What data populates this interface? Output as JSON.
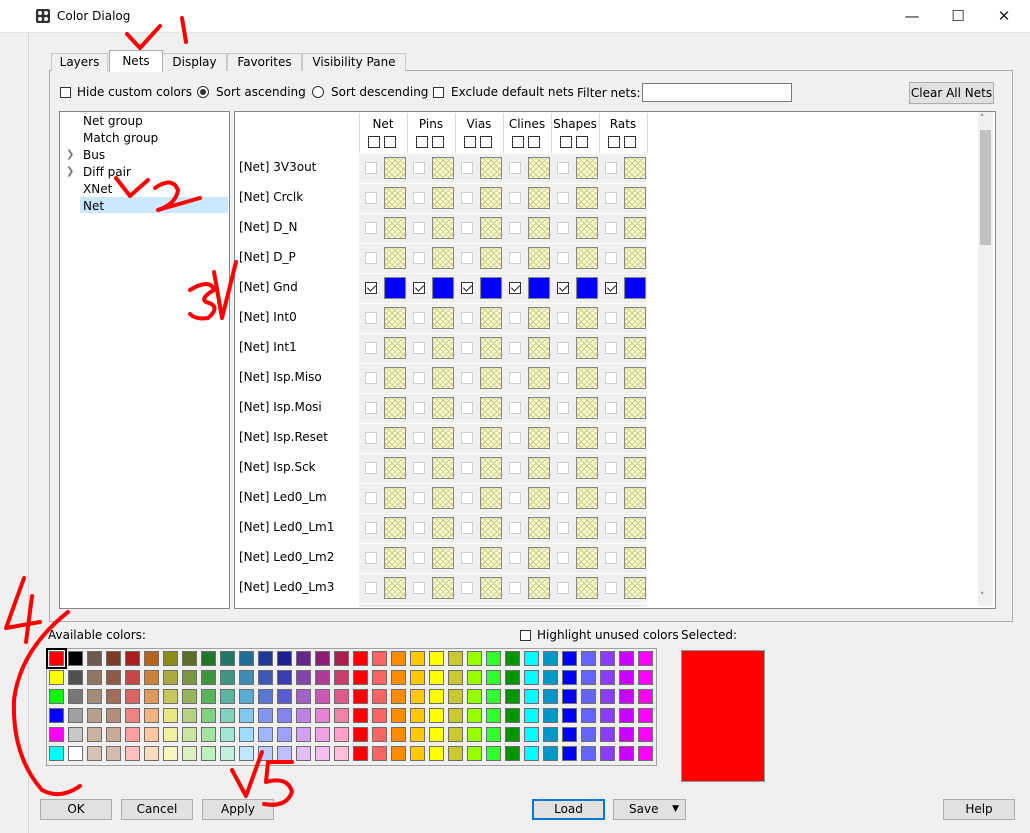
{
  "window": {
    "title": "Color Dialog",
    "minimize": "—",
    "maximize": "☐",
    "close": "✕"
  },
  "tabs": [
    "Layers",
    "Nets",
    "Display",
    "Favorites",
    "Visibility Pane"
  ],
  "active_tab": "Nets",
  "controls": {
    "hide_custom_colors": "Hide custom colors",
    "sort_ascending": "Sort ascending",
    "sort_descending": "Sort descending",
    "exclude_default_nets": "Exclude default nets",
    "filter_nets_label": "Filter nets:",
    "filter_nets_value": "",
    "clear_all_nets": "Clear All Nets"
  },
  "tree": {
    "items": [
      {
        "label": "Net group",
        "expandable": false
      },
      {
        "label": "Match group",
        "expandable": false
      },
      {
        "label": "Bus",
        "expandable": true
      },
      {
        "label": "Diff pair",
        "expandable": true
      },
      {
        "label": "XNet",
        "expandable": false
      },
      {
        "label": "Net",
        "expandable": false,
        "selected": true
      }
    ]
  },
  "grid": {
    "columns": [
      "Net",
      "Pins",
      "Vias",
      "Clines",
      "Shapes",
      "Rats"
    ],
    "rows": [
      {
        "label": "[Net] 3V3out",
        "checked": false,
        "color": "none"
      },
      {
        "label": "[Net] Crclk",
        "checked": false,
        "color": "none"
      },
      {
        "label": "[Net] D_N",
        "checked": false,
        "color": "none"
      },
      {
        "label": "[Net] D_P",
        "checked": false,
        "color": "none"
      },
      {
        "label": "[Net] Gnd",
        "checked": true,
        "color": "#0000ff"
      },
      {
        "label": "[Net] Int0",
        "checked": false,
        "color": "none"
      },
      {
        "label": "[Net] Int1",
        "checked": false,
        "color": "none"
      },
      {
        "label": "[Net] Isp.Miso",
        "checked": false,
        "color": "none"
      },
      {
        "label": "[Net] Isp.Mosi",
        "checked": false,
        "color": "none"
      },
      {
        "label": "[Net] Isp.Reset",
        "checked": false,
        "color": "none"
      },
      {
        "label": "[Net] Isp.Sck",
        "checked": false,
        "color": "none"
      },
      {
        "label": "[Net] Led0_Lm",
        "checked": false,
        "color": "none"
      },
      {
        "label": "[Net] Led0_Lm1",
        "checked": false,
        "color": "none"
      },
      {
        "label": "[Net] Led0_Lm2",
        "checked": false,
        "color": "none"
      },
      {
        "label": "[Net] Led0_Lm3",
        "checked": false,
        "color": "none"
      }
    ]
  },
  "palette": {
    "label": "Available colors:",
    "highlight_unused": "Highlight unused colors",
    "selected_label": "Selected:",
    "selected_color": "#ff0000",
    "selected_index": [
      0,
      0
    ],
    "rows": [
      [
        "#ff0000",
        "#000000",
        "#6e5a50",
        "#7d3c28",
        "#aa1e1e",
        "#b4641e",
        "#8c8c14",
        "#5a6e28",
        "#1e7828",
        "#1e7864",
        "#1e6e96",
        "#1e3c96",
        "#1e1e96",
        "#64288c",
        "#8c1e78",
        "#aa1e50",
        "#ff0000",
        "#ff6464",
        "#ff8c00",
        "#ffc800",
        "#ffff00",
        "#c8c832",
        "#96ff00",
        "#32ff32",
        "#009600",
        "#00ffff",
        "#0096c8",
        "#0000ff",
        "#6464ff",
        "#8c3cff",
        "#c800ff",
        "#ff00ff"
      ],
      [
        "#ffff00",
        "#505050",
        "#8c7864",
        "#8c5a46",
        "#c84646",
        "#c8823c",
        "#aaaa3c",
        "#78963c",
        "#3c963c",
        "#3c9682",
        "#3c8cb4",
        "#3c5ab4",
        "#3c3cb4",
        "#8246aa",
        "#aa3c96",
        "#c83c6e",
        "#ff0000",
        "#ff6464",
        "#ff8c00",
        "#ffc800",
        "#ffff00",
        "#c8c832",
        "#96ff00",
        "#32ff32",
        "#009600",
        "#00ffff",
        "#0096c8",
        "#0000ff",
        "#6464ff",
        "#8c3cff",
        "#c800ff",
        "#ff00ff"
      ],
      [
        "#00ff00",
        "#787878",
        "#a08c78",
        "#a06e5a",
        "#dc6464",
        "#dc9b5a",
        "#c8c85a",
        "#96b45a",
        "#5ab45a",
        "#5ab4a0",
        "#5aaad2",
        "#5a78d2",
        "#5a5ad2",
        "#a064c8",
        "#c85ab4",
        "#dc5a8c",
        "#ff0000",
        "#ff6464",
        "#ff8c00",
        "#ffc800",
        "#ffff00",
        "#c8c832",
        "#96ff00",
        "#32ff32",
        "#009600",
        "#00ffff",
        "#0096c8",
        "#0000ff",
        "#6464ff",
        "#8c3cff",
        "#c800ff",
        "#ff00ff"
      ],
      [
        "#0000ff",
        "#a0a0a0",
        "#b4a08c",
        "#b48c78",
        "#f08282",
        "#f0b482",
        "#e6e682",
        "#b4d282",
        "#82d282",
        "#82d2be",
        "#82c8f0",
        "#8296f0",
        "#8282f0",
        "#be82e6",
        "#e682d2",
        "#f082aa",
        "#ff0000",
        "#ff6464",
        "#ff8c00",
        "#ffc800",
        "#ffff00",
        "#c8c832",
        "#96ff00",
        "#32ff32",
        "#009600",
        "#00ffff",
        "#0096c8",
        "#0000ff",
        "#6464ff",
        "#8c3cff",
        "#c800ff",
        "#ff00ff"
      ],
      [
        "#ff00ff",
        "#c8c8c8",
        "#c8b4a0",
        "#c8aa96",
        "#ffa0a0",
        "#ffc8a0",
        "#f0f0a0",
        "#c8e6a0",
        "#a0e6a0",
        "#a0e6d2",
        "#a0dcff",
        "#a0b4ff",
        "#a0a0ff",
        "#d2a0f0",
        "#f0a0e6",
        "#ffa0c8",
        "#ff0000",
        "#ff6464",
        "#ff8c00",
        "#ffc800",
        "#ffff00",
        "#c8c832",
        "#96ff00",
        "#32ff32",
        "#009600",
        "#00ffff",
        "#0096c8",
        "#0000ff",
        "#6464ff",
        "#8c3cff",
        "#c800ff",
        "#ff00ff"
      ],
      [
        "#00ffff",
        "#ffffff",
        "#d2c3b4",
        "#d2bcaf",
        "#ffbebe",
        "#ffdcbe",
        "#f5f5be",
        "#dcf0be",
        "#bef0be",
        "#bef0e1",
        "#bee6ff",
        "#becdff",
        "#bebeff",
        "#e1bef5",
        "#f5bef0",
        "#ffbedc",
        "#ff0000",
        "#ff6464",
        "#ff8c00",
        "#ffc800",
        "#ffff00",
        "#c8c832",
        "#96ff00",
        "#32ff32",
        "#009600",
        "#00ffff",
        "#0096c8",
        "#0000ff",
        "#6464ff",
        "#8c3cff",
        "#c800ff",
        "#ff00ff"
      ]
    ]
  },
  "buttons": {
    "ok": "OK",
    "cancel": "Cancel",
    "apply": "Apply",
    "load": "Load",
    "save": "Save",
    "help": "Help"
  },
  "annotations": [
    "V1",
    "V2",
    "3V",
    "4",
    "V5"
  ]
}
